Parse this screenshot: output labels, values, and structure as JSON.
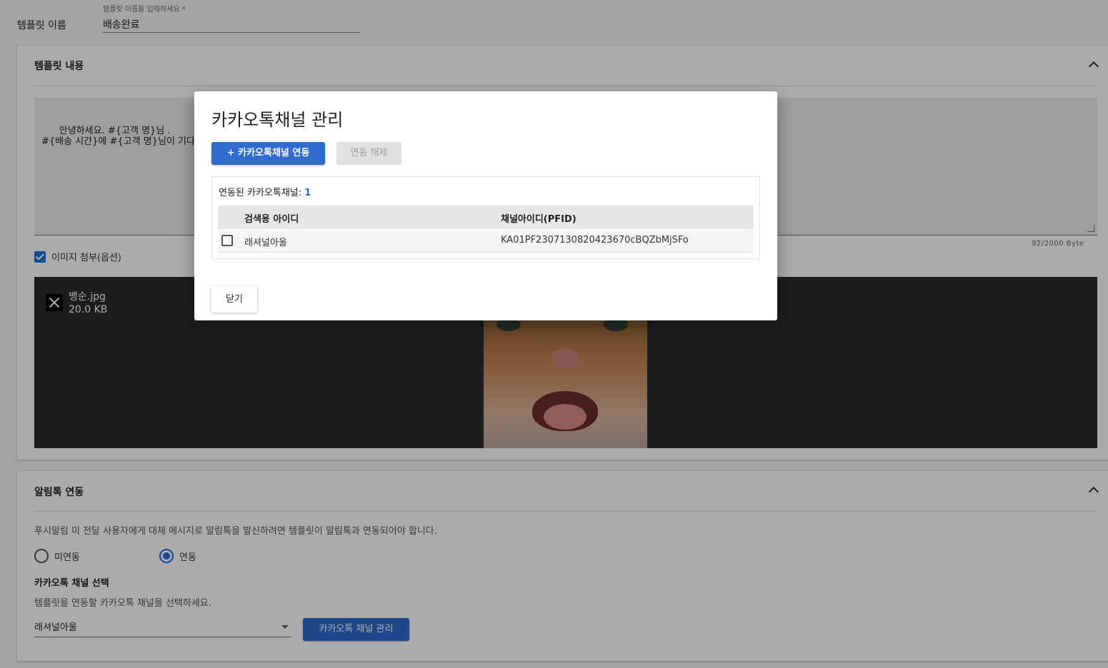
{
  "template_name": {
    "label": "템플릿 이름",
    "float_label": "템플릿 이름을 입력하세요 *",
    "value": "배송완료"
  },
  "content_section": {
    "title": "템플릿 내용",
    "text": "안녕하세요. #{고객 명}님 .\n#{배송 시간}에 #{고객 명}님이 기다",
    "byte_counter": "92/2000 Byte",
    "attach_label": "이미지 첨부(옵션)",
    "file_name": "뱅순.jpg",
    "file_size": "20.0 KB"
  },
  "alimtalk_section": {
    "title": "알림톡 연동",
    "description": "푸시알림 미 전달 사용자에게 대체 메시지로 알림톡을 발신하려면 템플릿이 알림톡과 연동되어야 합니다.",
    "radio_off": "미연동",
    "radio_on": "연동",
    "selected_radio": "연동",
    "channel_title": "카카오톡 채널 선택",
    "channel_desc": "템플릿을 연동할 카카오톡 채널을 선택하세요.",
    "channel_selected": "래셔널아울",
    "manage_button": "카카오톡 채널 관리"
  },
  "dialog": {
    "title": "카카오톡채널 관리",
    "link_button": "+ 카카오톡채널 연동",
    "unlink_button": "연동 해제",
    "count_label": "연동된 카카오톡채널: ",
    "count": "1",
    "columns": [
      "검색용 아이디",
      "채널아이디(PFID)"
    ],
    "rows": [
      {
        "search_id": "래셔널아울",
        "pfid": "KA01PF2307130820423670cBQZbMjSFo"
      }
    ],
    "close_button": "닫기"
  },
  "colors": {
    "accent": "#2f6bd0",
    "overlay": "rgba(0,0,0,0.33)"
  }
}
